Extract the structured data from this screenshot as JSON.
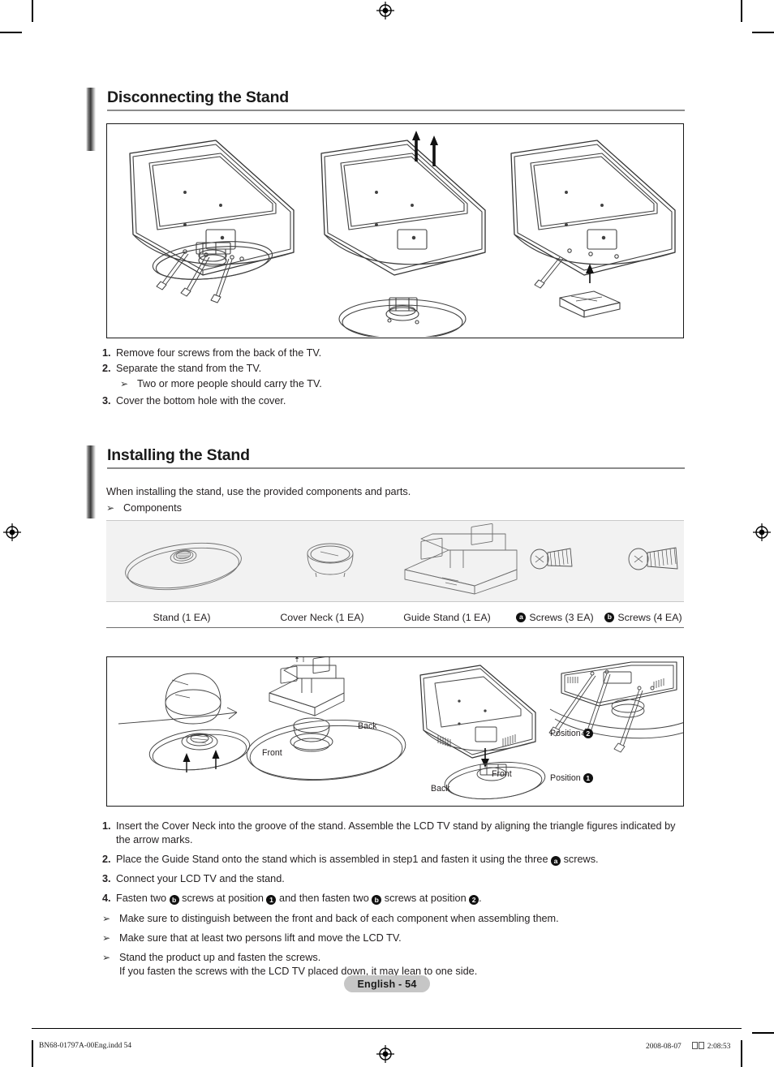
{
  "document": {
    "page_badge": "English - 54",
    "footer_left": "BN68-01797A-00Eng.indd   54",
    "footer_right_date": "2008-08-07",
    "footer_right_time": "2:08:53"
  },
  "section_disconnect": {
    "heading": "Disconnecting the Stand",
    "steps": [
      {
        "num": "1.",
        "text": "Remove four screws from the back of the TV."
      },
      {
        "num": "2.",
        "text": "Separate the stand from the TV."
      },
      {
        "num": "3.",
        "text": "Cover the bottom hole with the cover."
      }
    ],
    "substep_note": "Two or more people should carry the TV.",
    "bullet_glyph": "➢"
  },
  "section_install": {
    "heading": "Installing the Stand",
    "intro": "When installing the stand, use the provided components and parts.",
    "components_label": "Components",
    "bullet_glyph": "➢",
    "components": [
      {
        "label": "Stand (1 EA)",
        "mark": ""
      },
      {
        "label": "Cover Neck (1 EA)",
        "mark": ""
      },
      {
        "label": "Guide Stand (1 EA)",
        "mark": ""
      },
      {
        "label": "Screws (3 EA)",
        "mark": "a"
      },
      {
        "label": "Screws (4 EA)",
        "mark": "b"
      }
    ],
    "figure_labels": {
      "back_1": "Back",
      "front_1": "Front",
      "back_2": "Back",
      "front_2": "Front",
      "position_2": "Position",
      "position_1": "Position",
      "position_2_mark": "2",
      "position_1_mark": "1"
    },
    "steps": [
      {
        "num": "1.",
        "parts": [
          {
            "t": "text",
            "v": "Insert the Cover Neck into the groove of the stand. Assemble the LCD TV stand by aligning the triangle figures indicated by the arrow marks."
          }
        ]
      },
      {
        "num": "2.",
        "parts": [
          {
            "t": "text",
            "v": "Place the Guide Stand onto the stand which is assembled in step1 and fasten it using the three "
          },
          {
            "t": "mark",
            "v": "a"
          },
          {
            "t": "text",
            "v": " screws."
          }
        ]
      },
      {
        "num": "3.",
        "parts": [
          {
            "t": "text",
            "v": "Connect your LCD TV and the stand."
          }
        ]
      },
      {
        "num": "4.",
        "parts": [
          {
            "t": "text",
            "v": "Fasten two "
          },
          {
            "t": "mark",
            "v": "b"
          },
          {
            "t": "text",
            "v": " screws at position "
          },
          {
            "t": "mark",
            "v": "1"
          },
          {
            "t": "text",
            "v": " and then fasten two "
          },
          {
            "t": "mark",
            "v": "b"
          },
          {
            "t": "text",
            "v": " screws at position "
          },
          {
            "t": "mark",
            "v": "2"
          },
          {
            "t": "text",
            "v": "."
          }
        ]
      }
    ],
    "notes": [
      "Make sure to distinguish between the front and back of each component when assembling them.",
      "Make sure that at least two persons lift and move the LCD TV.",
      "Stand the product up and fasten the screws.\nIf you fasten the screws with the LCD TV placed down, it may lean to one side."
    ]
  },
  "colors": {
    "text": "#231f20",
    "rule": "#8c8c8c",
    "panel_bg": "#f2f2f2",
    "badge_bg": "#c6c6c6",
    "line_art": "#404040"
  }
}
